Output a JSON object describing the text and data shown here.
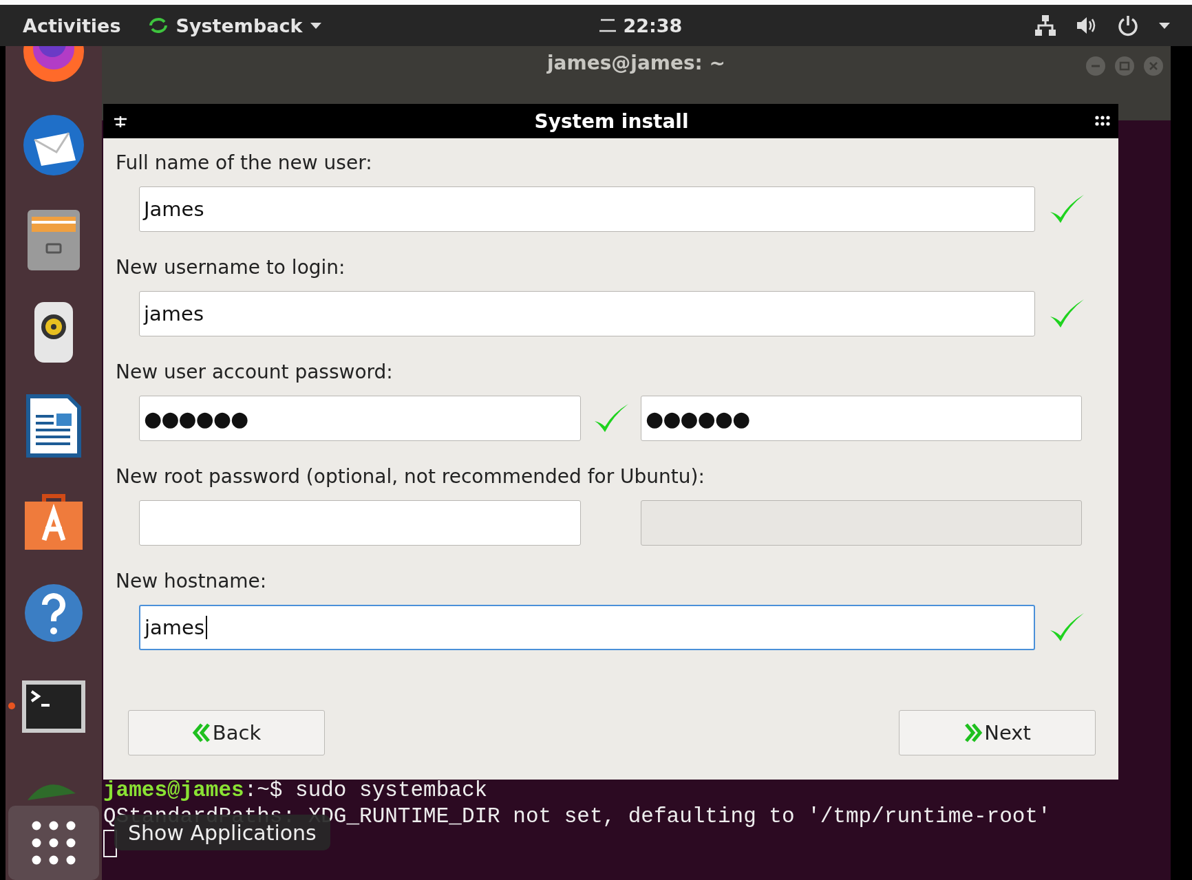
{
  "top_bar": {
    "activities": "Activities",
    "app_menu": "Systemback",
    "clock": "22:38"
  },
  "dock": {
    "items": [
      {
        "kind": "firefox",
        "running": false
      },
      {
        "kind": "mail",
        "running": false
      },
      {
        "kind": "files",
        "running": false
      },
      {
        "kind": "speaker",
        "running": false
      },
      {
        "kind": "writer",
        "running": false
      },
      {
        "kind": "store",
        "running": false
      },
      {
        "kind": "help",
        "running": false
      },
      {
        "kind": "terminal",
        "running": true
      },
      {
        "kind": "fish",
        "running": false
      }
    ],
    "tooltip": "Show Applications"
  },
  "terminal": {
    "title": "james@james: ~",
    "lines": [
      {
        "prompt": "james@james",
        "path": ":~$",
        "text": " sudo systemback"
      },
      {
        "text": "QStandardPaths: XDG_RUNTIME_DIR not set, defaulting to '/tmp/runtime-root'"
      }
    ]
  },
  "dialog": {
    "title": "System install",
    "sections": [
      {
        "label": "Full name of the new user:",
        "fields": [
          {
            "value": "James",
            "valid": true,
            "disabled": false,
            "focused": false
          }
        ]
      },
      {
        "label": "New username to login:",
        "fields": [
          {
            "value": "james",
            "valid": true,
            "disabled": false,
            "focused": false
          }
        ]
      },
      {
        "label": "New user account password:",
        "fields": [
          {
            "value": "●●●●●●",
            "valid": true,
            "disabled": false,
            "focused": false
          },
          {
            "value": "●●●●●●",
            "valid": false,
            "disabled": false,
            "focused": false
          }
        ]
      },
      {
        "label": "New root password (optional, not recommended for Ubuntu):",
        "fields": [
          {
            "valid": false,
            "disabled": false,
            "focused": false
          },
          {
            "valid": false,
            "disabled": true,
            "focused": false
          }
        ]
      },
      {
        "label": "New hostname:",
        "fields": [
          {
            "value": "james",
            "valid": true,
            "disabled": false,
            "focused": true
          }
        ]
      }
    ],
    "back": "Back",
    "next": "Next"
  }
}
